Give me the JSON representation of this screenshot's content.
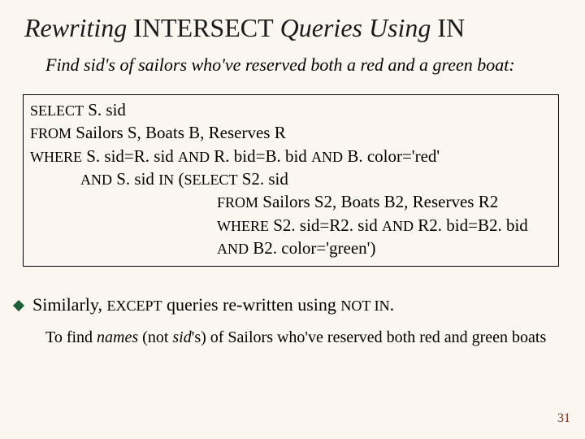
{
  "title": {
    "pre": "Rewriting ",
    "mid_sc": "INTERSECT",
    "post": " Queries Using ",
    "tail_sc": "IN"
  },
  "problem": "Find sid's of sailors who've reserved both a red and a green boat:",
  "sql": {
    "l1_kw": "SELECT",
    "l1_rest": "  S. sid",
    "l2_kw": "FROM",
    "l2_rest": "  Sailors S, Boats B, Reserves R",
    "l3_kw": "WHERE",
    "l3_a": "  S. sid=R. sid ",
    "l3_and1": "AND",
    "l3_b": " R. bid=B. bid ",
    "l3_and2": "AND",
    "l3_c": " B. color='red'",
    "l4_and": "AND",
    "l4_a": " S. sid ",
    "l4_in": "IN",
    "l4_b": "  (",
    "l4_kw": "SELECT",
    "l4_rest": "  S2. sid",
    "l5_kw": "FROM",
    "l5_rest": "  Sailors S2, Boats B2, Reserves R2",
    "l6_kw": "WHERE",
    "l6_a": "  S2. sid=R2. sid ",
    "l6_and": "AND",
    "l6_b": " R2. bid=B2. bid",
    "l7_and": "AND",
    "l7_rest": "  B2. color='green')"
  },
  "bullet": {
    "a": "Similarly, ",
    "b_sc": "EXCEPT",
    "c": " queries re-written using ",
    "d_sc": "NOT IN",
    "e": "."
  },
  "note": {
    "a": "To find ",
    "b_it": "names",
    "c": " (not ",
    "d_it": "sid",
    "e": "'s) of Sailors who've reserved both red and green boats"
  },
  "page": "31"
}
